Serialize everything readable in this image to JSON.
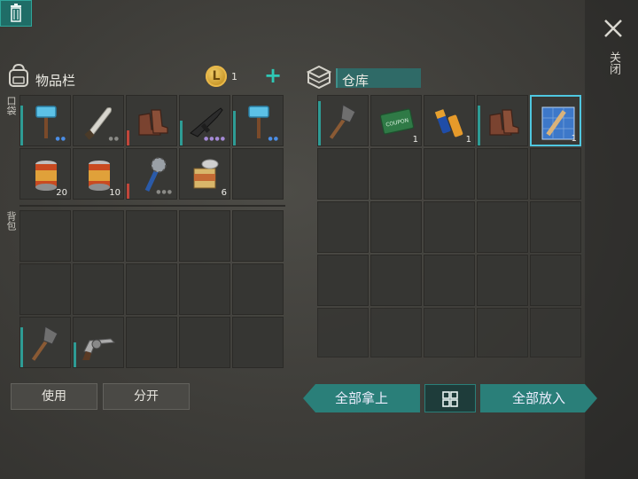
{
  "close": {
    "icon": "close-icon",
    "label": "关闭"
  },
  "inventory": {
    "title": "物品栏",
    "icon": "backpack-icon",
    "coin_icon": "coin-icon",
    "coin_symbol": "L",
    "coin_count": "1",
    "add_icon": "plus-icon",
    "pocket_label": "口袋",
    "backpack_label": "背包",
    "pocket_slots": [
      {
        "item": "hammer-icon",
        "qty": "",
        "durability": 0.8,
        "bar": "#2e9c95",
        "dots": "●●"
      },
      {
        "item": "machete-icon",
        "qty": "",
        "durability": 0,
        "bar": "",
        "dots": "●●"
      },
      {
        "item": "boots-icon",
        "qty": "",
        "durability": 0.3,
        "bar": "#c0463b",
        "dots": ""
      },
      {
        "item": "rifle-icon",
        "qty": "",
        "durability": 0.5,
        "bar": "#2e9c95",
        "dots": "●●●●"
      },
      {
        "item": "hammer-icon",
        "qty": "",
        "durability": 0.7,
        "bar": "#2e9c95",
        "dots": "●●"
      },
      {
        "item": "canned-food-icon",
        "qty": "20",
        "durability": 0,
        "bar": "",
        "dots": ""
      },
      {
        "item": "canned-food-icon",
        "qty": "10",
        "durability": 0,
        "bar": "",
        "dots": ""
      },
      {
        "item": "spiked-club-icon",
        "qty": "",
        "durability": 0.3,
        "bar": "#c0463b",
        "dots": "●●●"
      },
      {
        "item": "open-can-icon",
        "qty": "6",
        "durability": 0,
        "bar": "",
        "dots": ""
      },
      {
        "item": "",
        "qty": "",
        "durability": 0,
        "bar": "",
        "dots": ""
      }
    ],
    "backpack_slots": [
      {
        "item": ""
      },
      {
        "item": ""
      },
      {
        "item": ""
      },
      {
        "item": ""
      },
      {
        "item": ""
      },
      {
        "item": ""
      },
      {
        "item": ""
      },
      {
        "item": ""
      },
      {
        "item": ""
      },
      {
        "item": ""
      },
      {
        "item": "shovel-icon",
        "durability": 0.8,
        "bar": "#2e9c95"
      },
      {
        "item": "revolver-icon",
        "durability": 0.5,
        "bar": "#2e9c95"
      },
      {
        "item": ""
      },
      {
        "item": ""
      },
      {
        "item": ""
      }
    ],
    "use_button": "使用",
    "split_button": "分开",
    "trash_icon": "trash-icon"
  },
  "warehouse": {
    "title": "仓库",
    "icon": "crate-icon",
    "slots_row1": [
      {
        "item": "shovel-icon",
        "qty": "",
        "durability": 0.9,
        "bar": "#2e9c95"
      },
      {
        "item": "coupon-icon",
        "qty": "1",
        "durability": 0,
        "bar": "",
        "text": "RETURN COUPON"
      },
      {
        "item": "batteries-icon",
        "qty": "1",
        "durability": 0,
        "bar": ""
      },
      {
        "item": "boots-icon",
        "qty": "",
        "durability": 0.8,
        "bar": "#2e9c95"
      },
      {
        "item": "blueprint-icon",
        "qty": "1",
        "durability": 0,
        "bar": "",
        "selected": true
      }
    ],
    "take_all_button": "全部拿上",
    "sort_icon": "grid-icon",
    "put_all_button": "全部放入"
  }
}
